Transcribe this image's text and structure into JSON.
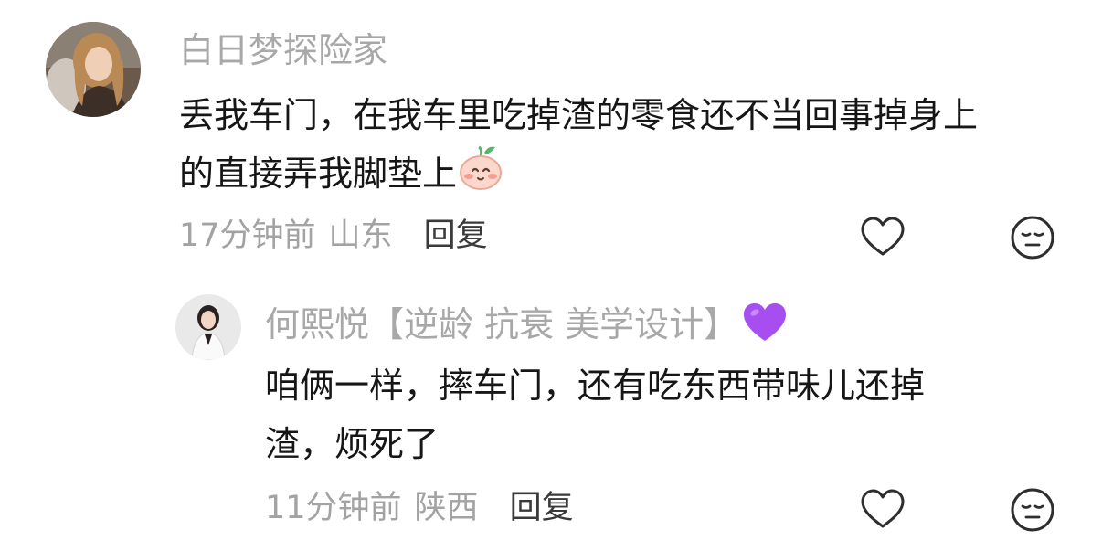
{
  "comments": [
    {
      "username": "白日梦探险家",
      "text_line1": "丢我车门，在我车里吃掉渣的零食还不当回事掉身上",
      "text_line2": "的直接弄我脚垫上",
      "inline_emoji": "blush-peach-emoji",
      "time": "17分钟前",
      "location": "山东",
      "reply_label": "回复",
      "like_icon": "heart-outline-icon",
      "react_icon": "relieved-face-icon"
    },
    {
      "username": "何熙悦【逆龄 抗衰 美学设计】",
      "username_emoji": "purple-heart-emoji",
      "text_line1": "咱俩一样，摔车门，还有吃东西带味儿还掉",
      "text_line2": "渣，烦死了",
      "time": "11分钟前",
      "location": "陕西",
      "reply_label": "回复",
      "like_icon": "heart-outline-icon",
      "react_icon": "relieved-face-icon"
    }
  ],
  "colors": {
    "username": "#a8a8a8",
    "text": "#161616",
    "meta": "#a3a3a3",
    "reply": "#3a3a3a",
    "purple_heart": "#a64ef0"
  }
}
